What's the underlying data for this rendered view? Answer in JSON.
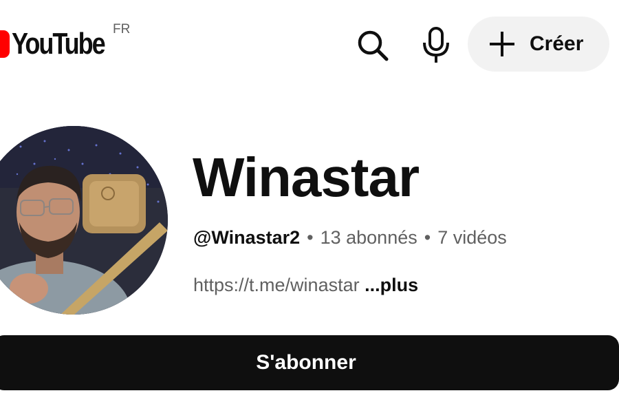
{
  "header": {
    "logo_text": "YouTube",
    "country_code": "FR",
    "search_icon": "search-icon",
    "mic_icon": "microphone-icon",
    "create_label": "Créer",
    "create_icon": "plus-icon"
  },
  "channel": {
    "name": "Winastar",
    "handle": "@Winastar2",
    "subscribers": "13 abonnés",
    "videos": "7 vidéos",
    "separator": "•",
    "link": "https://t.me/winastar",
    "more_label": "...plus",
    "subscribe_label": "S'abonner"
  },
  "colors": {
    "brand_red": "#ff0000",
    "text_primary": "#0f0f0f",
    "text_secondary": "#606060",
    "create_bg": "#f2f2f2",
    "subscribe_bg": "#0f0f0f"
  }
}
